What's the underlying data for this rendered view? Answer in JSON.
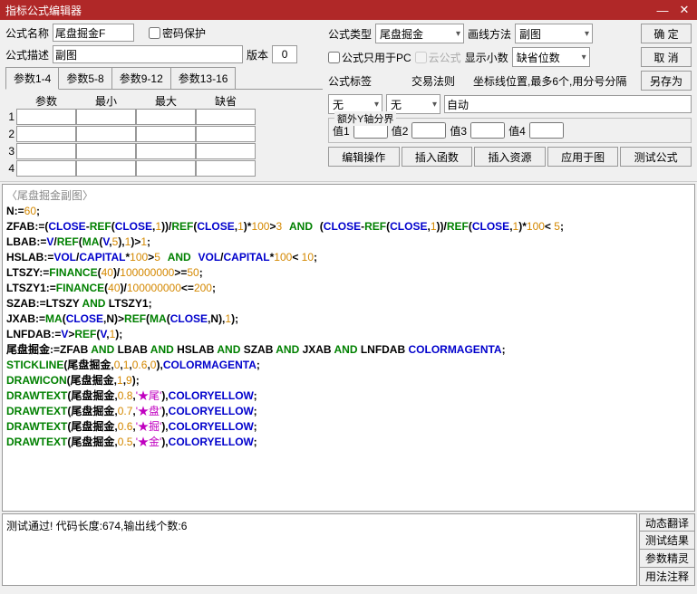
{
  "title": "指标公式编辑器",
  "labels": {
    "name": "公式名称",
    "pwd": "密码保护",
    "type": "公式类型",
    "draw": "画线方法",
    "desc": "公式描述",
    "ver": "版本",
    "pcOnly": "公式只用于PC",
    "cloud": "云公式",
    "decimal": "显示小数",
    "tag": "公式标签",
    "rule": "交易法则",
    "axisPos": "坐标线位置,最多6个,用分号分隔",
    "yExtra": "额外Y轴分界",
    "v1": "值1",
    "v2": "值2",
    "v3": "值3",
    "v4": "值4"
  },
  "values": {
    "name": "尾盘掘金F",
    "type": "尾盘掘金",
    "draw": "副图",
    "desc": "副图",
    "ver": "0",
    "decimal": "缺省位数",
    "tag": "无",
    "rule": "无",
    "axisPos": "自动"
  },
  "buttons": {
    "ok": "确 定",
    "cancel": "取 消",
    "saveAs": "另存为",
    "editOp": "编辑操作",
    "insFn": "插入函数",
    "insRes": "插入资源",
    "apply": "应用于图",
    "test": "测试公式",
    "dynTrans": "动态翻译",
    "testRes": "测试结果",
    "paramWiz": "参数精灵",
    "usage": "用法注释"
  },
  "paramTabs": [
    "参数1-4",
    "参数5-8",
    "参数9-12",
    "参数13-16"
  ],
  "paramHead": [
    "参数",
    "最小",
    "最大",
    "缺省"
  ],
  "paramRows": [
    "1",
    "2",
    "3",
    "4"
  ],
  "codeTitle": "〈尾盘掘金副图〉",
  "status": "测试通过! 代码长度:674,输出线个数:6"
}
